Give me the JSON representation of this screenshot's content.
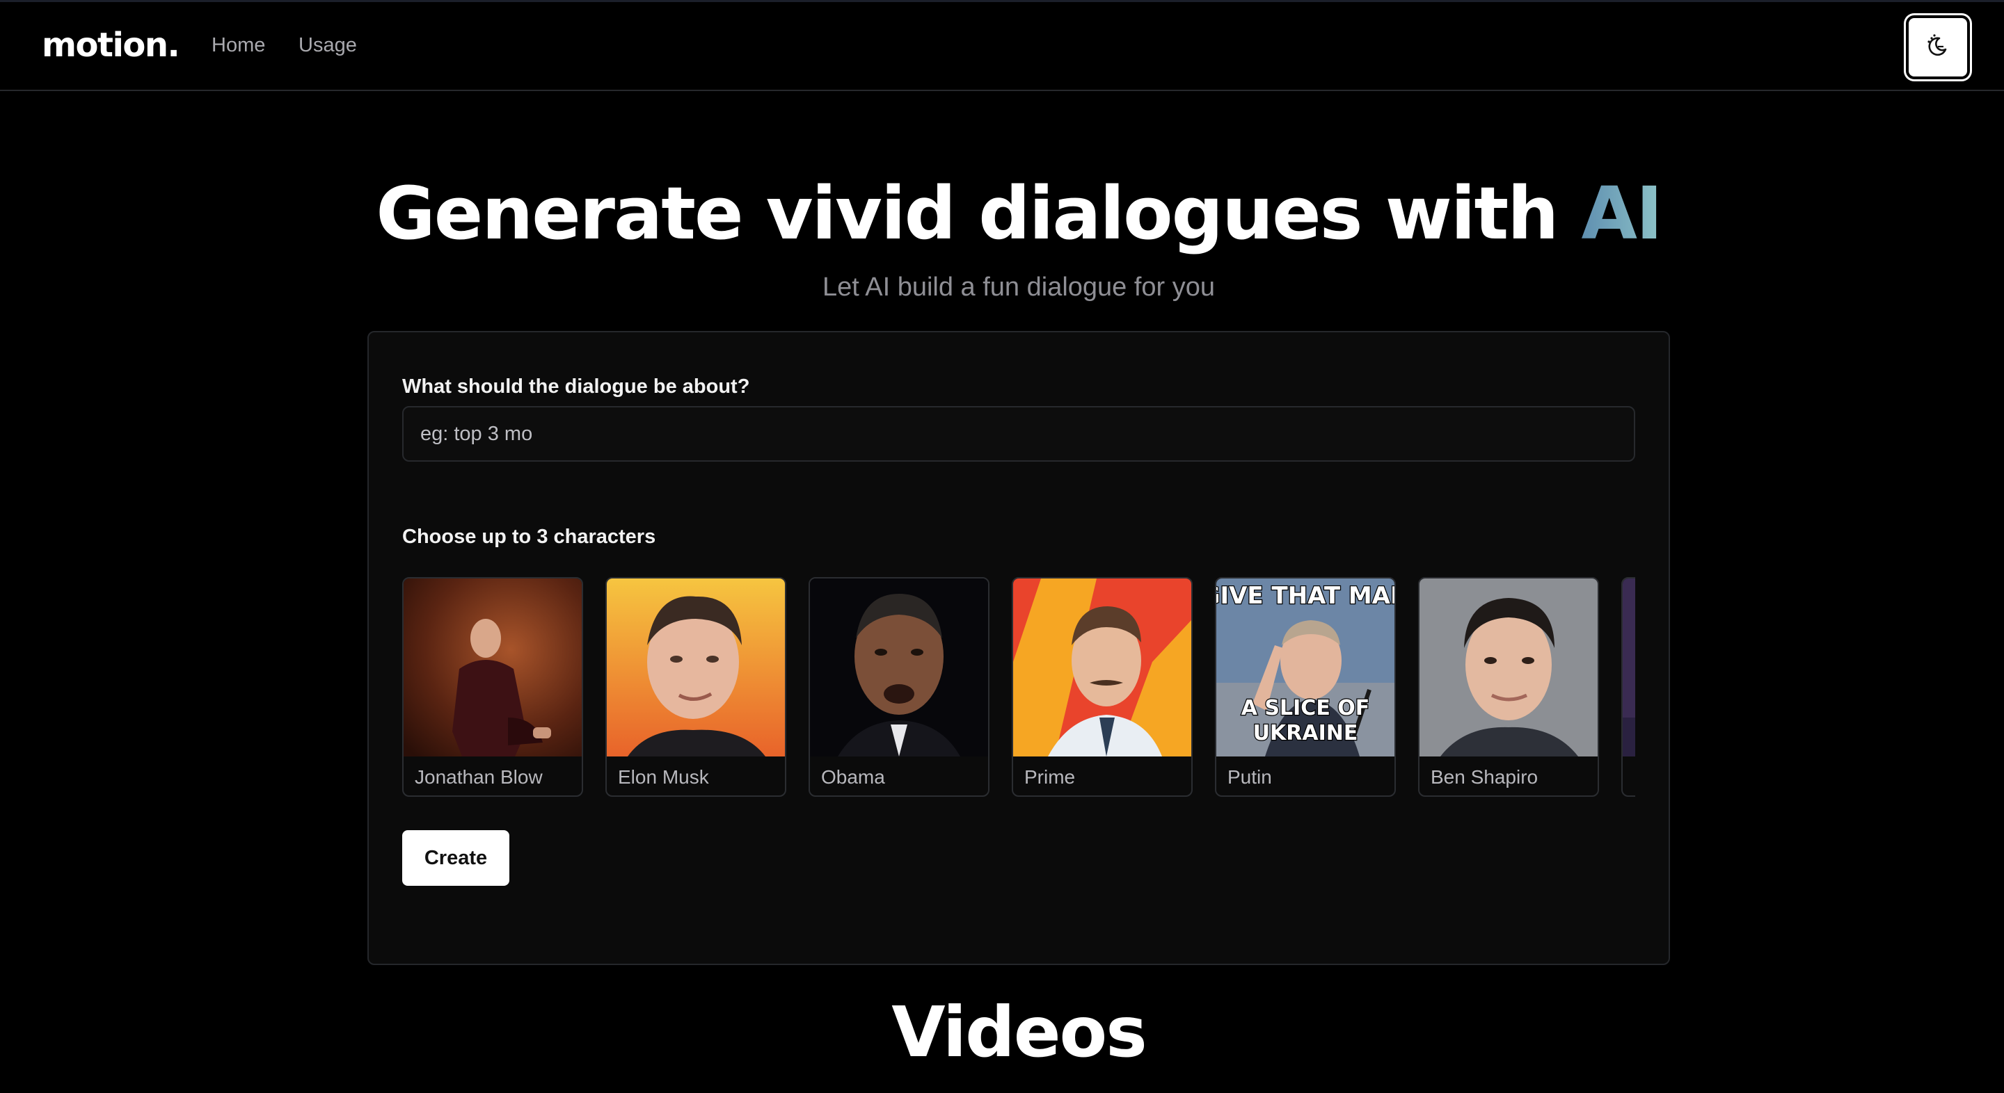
{
  "nav": {
    "logo": "motion.",
    "links": [
      "Home",
      "Usage"
    ],
    "theme_toggle_icon": "moon-sun-icon"
  },
  "hero": {
    "title_main": "Generate vivid dialogues with",
    "title_accent": "AI",
    "subtitle": "Let AI build a fun dialogue for you"
  },
  "form": {
    "topic_label": "What should the dialogue be about?",
    "topic_value": "eg: top 3 mo",
    "characters_label": "Choose up to 3 characters",
    "characters": [
      {
        "name": "Jonathan Blow",
        "image": "portrait-photo"
      },
      {
        "name": "Elon Musk",
        "image": "portrait-photo"
      },
      {
        "name": "Obama",
        "image": "portrait-photo"
      },
      {
        "name": "Prime",
        "image": "portrait-photo"
      },
      {
        "name": "Putin",
        "image": "meme-image",
        "meme_top": "GIVE THAT MAN",
        "meme_bottom": "A SLICE OF UKRAINE"
      },
      {
        "name": "Ben Shapiro",
        "image": "portrait-photo"
      },
      {
        "name": "",
        "image": "portrait-photo"
      }
    ],
    "create_label": "Create"
  },
  "videos": {
    "title": "Videos"
  },
  "colors": {
    "background": "#000000",
    "card": "#0b0b0b",
    "accent_gradient": [
      "#5f8fb0",
      "#8ec3c8"
    ],
    "muted_text": "#8f8f95"
  }
}
